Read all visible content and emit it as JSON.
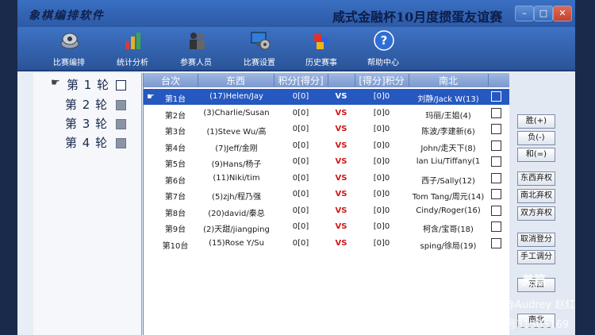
{
  "window": {
    "logo_text": "象棋编排软件",
    "title": "咸式金融杯10月度掼蛋友谊赛",
    "controls": {
      "minimize": "–",
      "maximize": "□",
      "close": "✕"
    }
  },
  "toolbar": {
    "items": [
      {
        "label": "比赛编排",
        "icon": "schedule-icon"
      },
      {
        "label": "统计分析",
        "icon": "chart-icon"
      },
      {
        "label": "参赛人员",
        "icon": "people-icon"
      },
      {
        "label": "比赛设置",
        "icon": "settings-icon"
      },
      {
        "label": "历史赛事",
        "icon": "history-icon"
      },
      {
        "label": "帮助中心",
        "icon": "help-icon"
      }
    ]
  },
  "rounds": [
    {
      "label": "第 1 轮",
      "active": true
    },
    {
      "label": "第 2 轮",
      "active": false
    },
    {
      "label": "第 3 轮",
      "active": false
    },
    {
      "label": "第 4 轮",
      "active": false
    }
  ],
  "table": {
    "headers": [
      "台次",
      "东西",
      "积分[得分]",
      "",
      "[得分]积分",
      "南北",
      ""
    ],
    "rows": [
      {
        "table": "第1台",
        "east_west": "(17)Helen/Jay",
        "ew_score": "0[0]",
        "vs": "VS",
        "ns_score": "[0]0",
        "north_south": "刘静/Jack W(13)",
        "selected": true
      },
      {
        "table": "第2台",
        "east_west": "(3)Charlie/Susan",
        "ew_score": "0[0]",
        "vs": "VS",
        "ns_score": "[0]0",
        "north_south": "玛丽/王姐(4)",
        "selected": false
      },
      {
        "table": "第3台",
        "east_west": "(1)Steve Wu/高",
        "ew_score": "0[0]",
        "vs": "VS",
        "ns_score": "[0]0",
        "north_south": "陈波/李建新(6)",
        "selected": false
      },
      {
        "table": "第4台",
        "east_west": "(7)Jeff/金刚",
        "ew_score": "0[0]",
        "vs": "VS",
        "ns_score": "[0]0",
        "north_south": "John/走天下(8)",
        "selected": false
      },
      {
        "table": "第5台",
        "east_west": "(9)Hans/杨子",
        "ew_score": "0[0]",
        "vs": "VS",
        "ns_score": "[0]0",
        "north_south": "lan Liu/Tiffany(1",
        "selected": false
      },
      {
        "table": "第6台",
        "east_west": "(11)Niki/tim",
        "ew_score": "0[0]",
        "vs": "VS",
        "ns_score": "[0]0",
        "north_south": "西子/Sally(12)",
        "selected": false
      },
      {
        "table": "第7台",
        "east_west": "(5)zjh/程乃强",
        "ew_score": "0[0]",
        "vs": "VS",
        "ns_score": "[0]0",
        "north_south": "Tom Tang/周元(14)",
        "selected": false
      },
      {
        "table": "第8台",
        "east_west": "(20)david/秦总",
        "ew_score": "0[0]",
        "vs": "VS",
        "ns_score": "[0]0",
        "north_south": "Cindy/Roger(16)",
        "selected": false
      },
      {
        "table": "第9台",
        "east_west": "(2)天甜/jiangping",
        "ew_score": "0[0]",
        "vs": "VS",
        "ns_score": "[0]0",
        "north_south": "柯含/宝哥(18)",
        "selected": false
      },
      {
        "table": "第10台",
        "east_west": "(15)Rose Y/Su",
        "ew_score": "0[0]",
        "vs": "VS",
        "ns_score": "[0]0",
        "north_south": "sping/徐局(19)",
        "selected": false
      }
    ]
  },
  "side_buttons": [
    {
      "label": "胜(+)"
    },
    {
      "label": "负(-)"
    },
    {
      "label": "和(=)"
    },
    {
      "label": "东西弃权"
    },
    {
      "label": "南北弃权"
    },
    {
      "label": "双方弃权"
    },
    {
      "label": "取消登分"
    },
    {
      "label": "手工调分"
    },
    {
      "label": "东西"
    },
    {
      "label": "南北"
    }
  ],
  "watermark": {
    "brand": "美篇",
    "author": "@Audrey 赵红",
    "id": "美篇号31305169"
  },
  "colors": {
    "titlebar": "#2c5aa6",
    "selected_row": "#2558c0",
    "vs": "#d01818"
  }
}
